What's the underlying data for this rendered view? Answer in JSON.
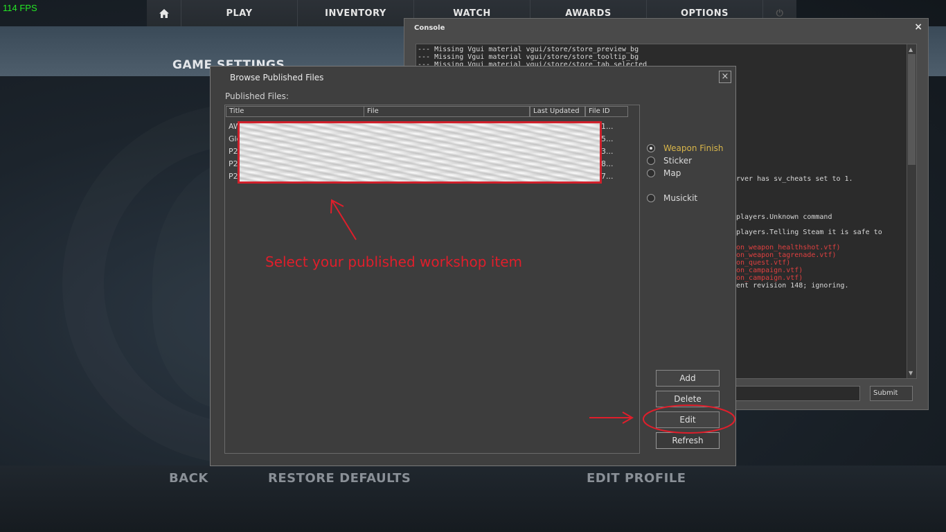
{
  "hud": {
    "fps": "114 FPS"
  },
  "topnav": {
    "items": [
      {
        "label": ""
      },
      {
        "label": "PLAY"
      },
      {
        "label": "INVENTORY"
      },
      {
        "label": "WATCH"
      },
      {
        "label": "AWARDS"
      },
      {
        "label": "OPTIONS"
      },
      {
        "label": "⏻"
      }
    ],
    "icons": {
      "home": "home-icon",
      "power": "power-icon"
    }
  },
  "page": {
    "title": "GAME SETTINGS",
    "footer": {
      "back": "BACK",
      "restore": "RESTORE DEFAULTS",
      "edit_profile": "EDIT PROFILE"
    }
  },
  "console": {
    "title": "Console",
    "close": "×",
    "lines": [
      {
        "text": "--- Missing Vgui material vgui/store/store_preview_bg",
        "color": "#d8d8d8"
      },
      {
        "text": "--- Missing Vgui material vgui/store/store_tooltip_bg",
        "color": "#d8d8d8"
      },
      {
        "text": "--- Missing Vgui material vgui/store/store_tab_selected",
        "color": "#d8d8d8"
      },
      {
        "text": "rver has sv_cheats set to 1.",
        "color": "#d8d8d8"
      },
      {
        "text": "players.Unknown command",
        "color": "#d8d8d8"
      },
      {
        "text": "players.Telling Steam it is safe to",
        "color": "#d8d8d8"
      },
      {
        "text": "on_weapon_healthshot.vtf)",
        "color": "#e04040"
      },
      {
        "text": "on_weapon_tagrenade.vtf)",
        "color": "#e04040"
      },
      {
        "text": "on_quest.vtf)",
        "color": "#e04040"
      },
      {
        "text": "on_campaign.vtf)",
        "color": "#e04040"
      },
      {
        "text": "on_campaign.vtf)",
        "color": "#e04040"
      },
      {
        "text": "ent revision 148; ignoring.",
        "color": "#d8d8d8"
      }
    ],
    "input_value": "",
    "submit_label": "Submit"
  },
  "dialog": {
    "title": "Browse Published Files",
    "close": "×",
    "list_label": "Published Files:",
    "columns": [
      "Title",
      "File",
      "Last Updated",
      "File ID"
    ],
    "rows": [
      {
        "title": "AW",
        "file_id": "2791..."
      },
      {
        "title": "Glo",
        "file_id": "2405..."
      },
      {
        "title": "P2",
        "file_id": "8213..."
      },
      {
        "title": "P2",
        "file_id": "8238..."
      },
      {
        "title": "P2",
        "file_id": "8237..."
      }
    ],
    "categories": [
      {
        "label": "Weapon Finish",
        "selected": true
      },
      {
        "label": "Sticker",
        "selected": false
      },
      {
        "label": "Map",
        "selected": false
      },
      {
        "label": "Musickit",
        "selected": false
      }
    ],
    "buttons": {
      "add": "Add",
      "delete": "Delete",
      "edit": "Edit",
      "refresh": "Refresh"
    }
  },
  "annotation": {
    "text": "Select your published workshop item",
    "color": "#e01e2b"
  }
}
